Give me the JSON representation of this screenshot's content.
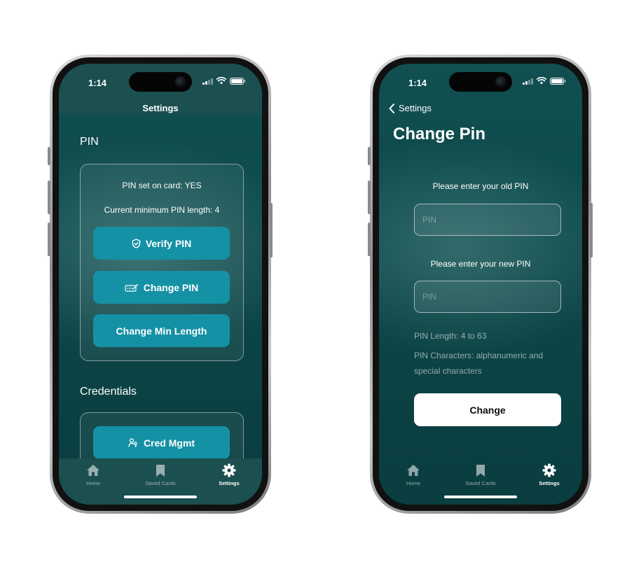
{
  "status": {
    "time": "1:14"
  },
  "phone1": {
    "nav_title": "Settings",
    "pin_section": {
      "title": "PIN",
      "pin_set_text": "PIN set on card: YES",
      "min_length_text": "Current minimum PIN length: 4",
      "buttons": {
        "verify": "Verify PIN",
        "change": "Change PIN",
        "min_length": "Change Min Length"
      }
    },
    "credentials_section": {
      "title": "Credentials",
      "buttons": {
        "cred_mgmt": "Cred Mgmt"
      }
    }
  },
  "phone2": {
    "back_label": "Settings",
    "title": "Change Pin",
    "old_pin_prompt": "Please enter your old PIN",
    "new_pin_prompt": "Please enter your new PIN",
    "old_pin": {
      "value": "",
      "placeholder": "PIN"
    },
    "new_pin": {
      "value": "",
      "placeholder": "PIN"
    },
    "hint_length": "PIN Length: 4 to 63",
    "hint_chars": "PIN Characters: alphanumeric and special characters",
    "submit": "Change"
  },
  "tabs": [
    {
      "label": "Home",
      "icon": "house-icon",
      "active": false
    },
    {
      "label": "Saved Cards",
      "icon": "bookmark-icon",
      "active": false
    },
    {
      "label": "Settings",
      "icon": "gear-icon",
      "active": true
    }
  ],
  "colors": {
    "background_top": "#114f51",
    "background_bottom": "#0a3d3f",
    "bar": "#1c4f50",
    "accent_button": "#1591a5",
    "primary_button": "#ffffff"
  }
}
